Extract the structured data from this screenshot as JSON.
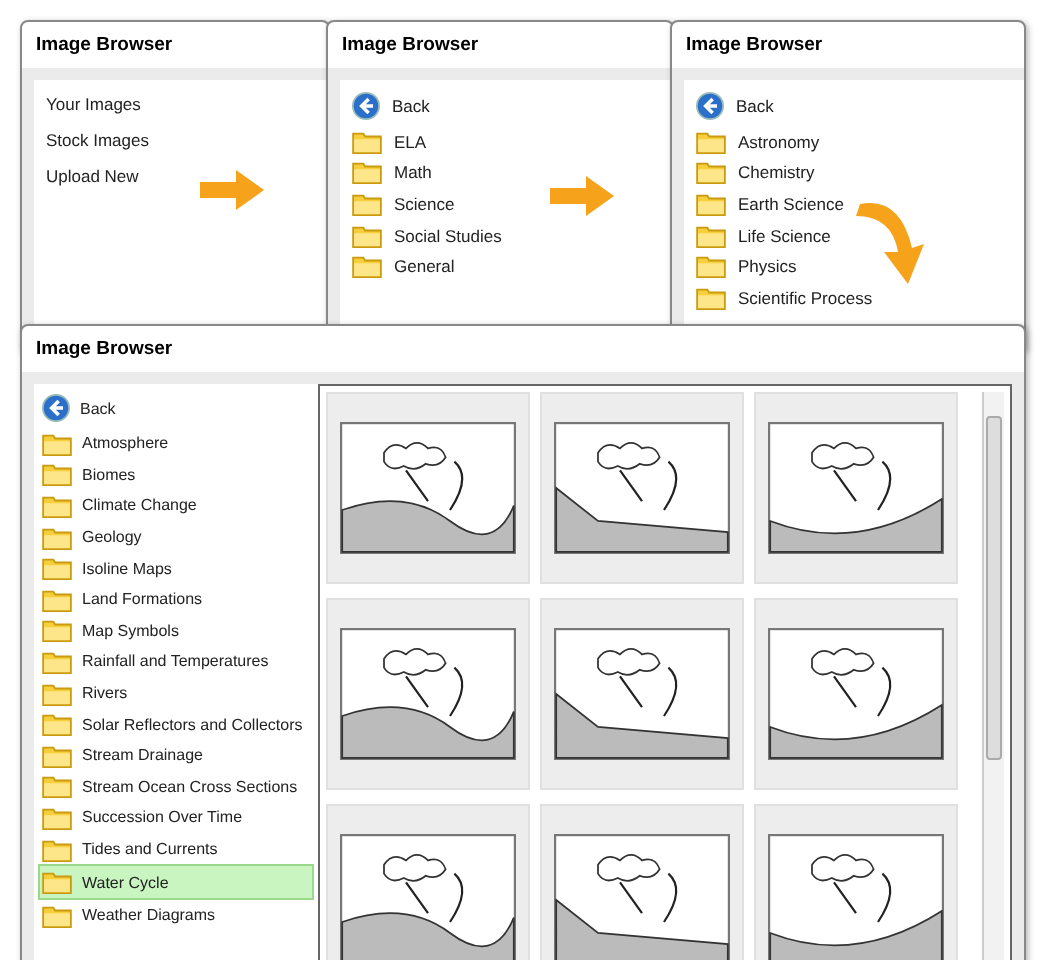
{
  "panels": [
    {
      "title": "Image Browser",
      "items": [
        {
          "kind": "text",
          "label": "Your Images",
          "selected": false
        },
        {
          "kind": "text",
          "label": "Stock Images",
          "selected": false
        },
        {
          "kind": "text",
          "label": "Upload New",
          "selected": false
        }
      ]
    },
    {
      "title": "Image Browser",
      "back_label": "Back",
      "items": [
        {
          "kind": "folder",
          "label": "ELA",
          "selected": false
        },
        {
          "kind": "folder",
          "label": "Math",
          "selected": false
        },
        {
          "kind": "folder",
          "label": "Science",
          "selected": false
        },
        {
          "kind": "folder",
          "label": "Social Studies",
          "selected": false
        },
        {
          "kind": "folder",
          "label": "General",
          "selected": false
        }
      ]
    },
    {
      "title": "Image Browser",
      "back_label": "Back",
      "items": [
        {
          "kind": "folder",
          "label": "Astronomy",
          "selected": false
        },
        {
          "kind": "folder",
          "label": "Chemistry",
          "selected": false
        },
        {
          "kind": "folder",
          "label": "Earth Science",
          "selected": false
        },
        {
          "kind": "folder",
          "label": "Life Science",
          "selected": false
        },
        {
          "kind": "folder",
          "label": "Physics",
          "selected": false
        },
        {
          "kind": "folder",
          "label": "Scientific Process",
          "selected": false
        }
      ]
    }
  ],
  "browser": {
    "title": "Image Browser",
    "back_label": "Back",
    "items": [
      {
        "kind": "folder",
        "label": "Atmosphere",
        "selected": false
      },
      {
        "kind": "folder",
        "label": "Biomes",
        "selected": false
      },
      {
        "kind": "folder",
        "label": "Climate Change",
        "selected": false
      },
      {
        "kind": "folder",
        "label": "Geology",
        "selected": false
      },
      {
        "kind": "folder",
        "label": "Isoline Maps",
        "selected": false
      },
      {
        "kind": "folder",
        "label": "Land Formations",
        "selected": false
      },
      {
        "kind": "folder",
        "label": "Map Symbols",
        "selected": false
      },
      {
        "kind": "folder",
        "label": "Rainfall and Temperatures",
        "selected": false
      },
      {
        "kind": "folder",
        "label": "Rivers",
        "selected": false
      },
      {
        "kind": "folder",
        "label": "Solar Reflectors and Collectors",
        "selected": false
      },
      {
        "kind": "folder",
        "label": "Stream Drainage",
        "selected": false
      },
      {
        "kind": "folder",
        "label": "Stream Ocean Cross Sections",
        "selected": false
      },
      {
        "kind": "folder",
        "label": "Succession Over Time",
        "selected": false
      },
      {
        "kind": "folder",
        "label": "Tides and Currents",
        "selected": false
      },
      {
        "kind": "folder",
        "label": "Water Cycle",
        "selected": true
      },
      {
        "kind": "folder",
        "label": "Weather Diagrams",
        "selected": false
      }
    ]
  }
}
